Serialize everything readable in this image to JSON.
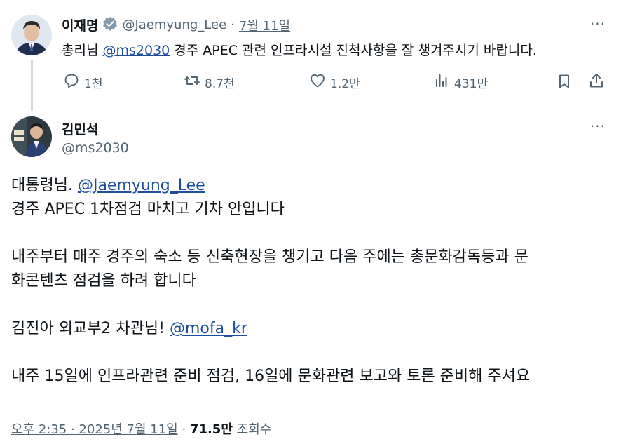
{
  "parent": {
    "name": "이재명",
    "handle": "@Jaemyung_Lee",
    "separator": "·",
    "date": "7월 11일",
    "text_before": "총리님 ",
    "mention": "@ms2030",
    "text_after": " 경주 APEC 관련 인프라시설 진척사항을 잘 챙겨주시기 바랍니다.",
    "actions": {
      "reply": "1천",
      "retweet": "8.7천",
      "like": "1.2만",
      "views": "431만"
    },
    "more": "···"
  },
  "main": {
    "name": "김민석",
    "handle": "@ms2030",
    "more": "···",
    "line1_prefix": "대통령님. ",
    "line1_mention": "@Jaemyung_Lee",
    "line2": "경주 APEC 1차점검 마치고 기차 안입니다",
    "para2_line1": "내주부터 매주 경주의 숙소 등 신축현장을 챙기고 다음 주에는 총문화감독등과 문",
    "para2_line2": "화콘텐츠 점검을 하려 합니다",
    "para3_prefix": "김진아 외교부2 차관님! ",
    "para3_mention": "@mofa_kr",
    "para4": "내주 15일에 인프라관련 준비 점검, 16일에 문화관련 보고와 토론 준비해 주셔요",
    "timestamp": "오후 2:35 · 2025년 7월 11일",
    "dot": "·",
    "views_count": "71.5만",
    "views_label": "조회수"
  },
  "colors": {
    "text": "#0f1419",
    "muted": "#536471",
    "link": "#1d4e9e",
    "verified": "#829aab",
    "thread_line": "#cfd9de"
  }
}
